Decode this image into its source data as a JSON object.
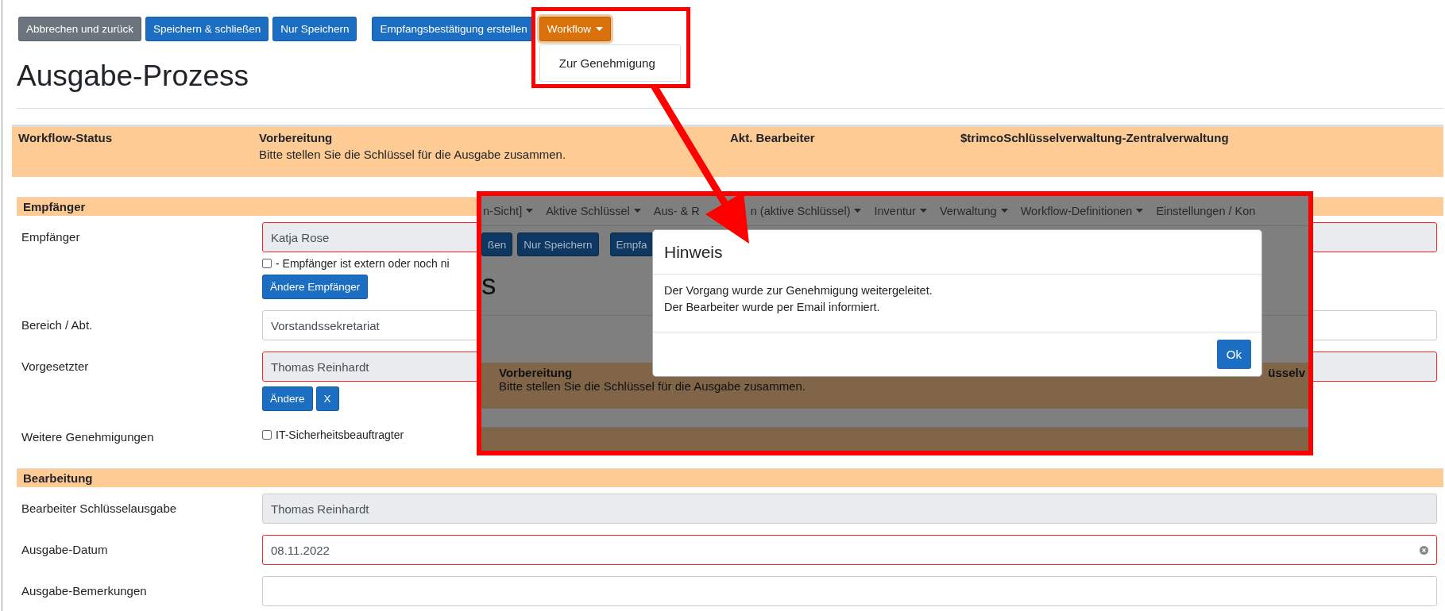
{
  "toolbar": {
    "buttons": [
      {
        "label": "Abbrechen und zurück",
        "kind": "secondary"
      },
      {
        "label": "Speichern & schließen",
        "kind": "primary"
      },
      {
        "label": "Nur Speichern",
        "kind": "primary"
      },
      {
        "label": "Empfangsbestätigung erstellen",
        "kind": "primary"
      }
    ],
    "workflow": {
      "label": "Workflow",
      "expanded": true,
      "items": [
        "Zur Genehmigung"
      ]
    }
  },
  "title": "Ausgabe-Prozess",
  "status": [
    {
      "label": "Workflow-Status",
      "value": "Vorbereitung",
      "note": "Bitte stellen Sie die Schlüssel für die Ausgabe zusammen."
    },
    {
      "label": "Akt. Bearbeiter",
      "value": "$trimcoSchlüsselverwaltung-Zentralverwaltung"
    }
  ],
  "sections": [
    {
      "title": "Empfänger",
      "rows": [
        {
          "label": "Empfänger",
          "field": {
            "value": "Katja Rose",
            "invalid": true,
            "readonly": true
          },
          "checkbox": {
            "label": "- Empfänger ist extern oder noch ni",
            "checked": false
          },
          "buttons": [
            "Ändere Empfänger"
          ]
        },
        {
          "label": "Bereich / Abt.",
          "field": {
            "value": "Vorstandssekretariat",
            "invalid": false,
            "readonly": false
          }
        },
        {
          "label": "Vorgesetzter",
          "field": {
            "value": "Thomas Reinhardt",
            "invalid": true,
            "readonly": true
          },
          "buttons": [
            "Ändere",
            "X"
          ]
        },
        {
          "label": "Weitere Genehmigungen",
          "checkbox": {
            "label": "IT-Sicherheitsbeauftragter",
            "checked": false
          }
        }
      ]
    },
    {
      "title": "Bearbeitung",
      "rows": [
        {
          "label": "Bearbeiter Schlüsselausgabe",
          "field": {
            "value": "Thomas Reinhardt",
            "invalid": false,
            "readonly": true
          }
        },
        {
          "label": "Ausgabe-Datum",
          "field": {
            "value": "08.11.2022",
            "invalid": true,
            "readonly": false,
            "clearable": true
          }
        },
        {
          "label": "Ausgabe-Bemerkungen",
          "field": {
            "invalid": false,
            "readonly": false
          }
        }
      ]
    }
  ],
  "inset": {
    "nav": [
      "n-Sicht]",
      "Aktive Schlüssel",
      "Aus- & R",
      "n (aktive Schlüssel)",
      "Inventur",
      "Verwaltung",
      "Workflow-Definitionen",
      "Einstellungen / Kon"
    ],
    "buttons": [
      "ßen",
      "Nur Speichern",
      "Empfa"
    ],
    "heading": "s",
    "status": {
      "value": "Vorbereitung",
      "note": "Bitte stellen Sie die Schlüssel für die Ausgabe zusammen.",
      "fragment": "üsselv"
    },
    "dialog": {
      "title": "Hinweis",
      "lines": [
        "Der Vorgang wurde zur Genehmigung weitergeleitet.",
        "Der Bearbeiter wurde per Email informiert."
      ],
      "button": "Ok"
    }
  }
}
